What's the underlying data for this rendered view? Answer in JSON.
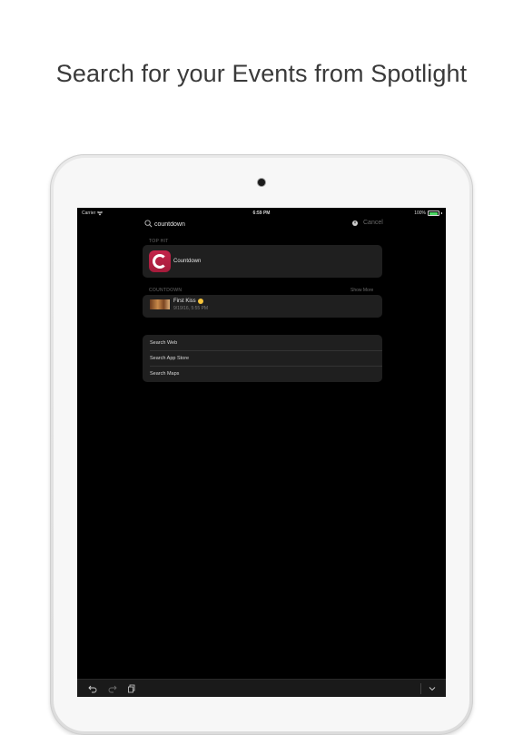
{
  "headline": "Search for your Events from Spotlight",
  "status_bar": {
    "carrier": "Carrier",
    "time": "6:59 PM",
    "battery": "100%"
  },
  "search": {
    "query": "countdown",
    "cancel_label": "Cancel"
  },
  "top_hit": {
    "section_label": "TOP HIT",
    "app_name": "Countdown"
  },
  "countdown_section": {
    "section_label": "COUNTDOWN",
    "show_more_label": "Show More",
    "event": {
      "title": "First Kiss",
      "date": "9/19/16, 5:55 PM"
    }
  },
  "search_options": [
    {
      "label": "Search Web"
    },
    {
      "label": "Search App Store"
    },
    {
      "label": "Search Maps"
    }
  ],
  "colors": {
    "app_icon": "#b3203f",
    "battery": "#4cd964",
    "screen_background": "#000000",
    "card_background": "#1f1f1f"
  },
  "icons": {
    "search": "search-icon",
    "clear": "clear-icon",
    "undo": "undo-icon",
    "redo": "redo-icon",
    "clipboard": "clipboard-icon",
    "keyboard_dismiss": "chevron-down-icon"
  }
}
